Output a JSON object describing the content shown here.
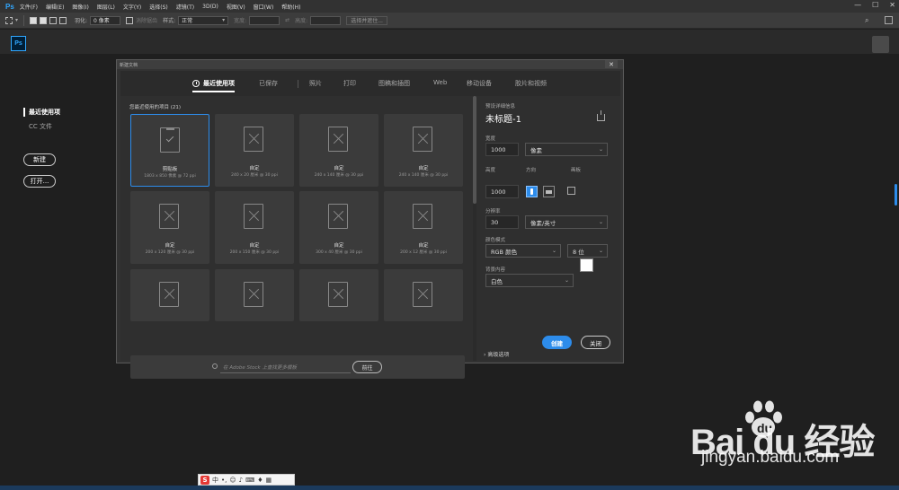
{
  "menubar": {
    "logo": "Ps",
    "items": [
      "文件(F)",
      "编辑(E)",
      "图像(I)",
      "图层(L)",
      "文字(Y)",
      "选择(S)",
      "滤镜(T)",
      "3D(D)",
      "视图(V)",
      "窗口(W)",
      "帮助(H)"
    ],
    "window_controls": [
      "—",
      "☐",
      "✕"
    ]
  },
  "optionsbar": {
    "feather_label": "羽化:",
    "feather_value": "0 像素",
    "antialias": "消除锯齿",
    "style_label": "样式:",
    "style_value": "正常",
    "width_label": "宽度:",
    "height_label": "高度:",
    "select_mask": "选择并遮住..."
  },
  "workspace": {
    "ps_logo": "Ps"
  },
  "start_panel": {
    "recent": "最近使用项",
    "cc_files": "CC 文件",
    "new_button": "新建",
    "open_button": "打开..."
  },
  "dialog": {
    "title": "新建文档",
    "close": "✕",
    "tabs": [
      "最近使用项",
      "已保存",
      "照片",
      "打印",
      "图稿和插图",
      "Web",
      "移动设备",
      "胶片和视频"
    ],
    "section_label": "您最近使用的项目 (21)",
    "presets": [
      {
        "name": "剪贴板",
        "dims": "1803 x 850 像素 @ 72 ppi"
      },
      {
        "name": "自定",
        "dims": "240 x 20 厘米 @ 30 ppi"
      },
      {
        "name": "自定",
        "dims": "240 x 140 厘米 @ 30 ppi"
      },
      {
        "name": "自定",
        "dims": "240 x 140 厘米 @ 30 ppi"
      },
      {
        "name": "自定",
        "dims": "200 x 120 厘米 @ 30 ppi"
      },
      {
        "name": "自定",
        "dims": "200 x 150 厘米 @ 30 ppi"
      },
      {
        "name": "自定",
        "dims": "300 x 40 厘米 @ 30 ppi"
      },
      {
        "name": "自定",
        "dims": "200 x 12 厘米 @ 30 ppi"
      },
      {
        "name": "",
        "dims": ""
      },
      {
        "name": "",
        "dims": ""
      },
      {
        "name": "",
        "dims": ""
      },
      {
        "name": "",
        "dims": ""
      }
    ],
    "stock_placeholder": "在 Adobe Stock 上查找更多模板",
    "go_button": "前往",
    "details": {
      "heading": "预设详细信息",
      "doc_name": "未标题-1",
      "width_label": "宽度",
      "width_value": "1000",
      "width_unit": "像素",
      "height_label": "高度",
      "height_value": "1000",
      "orientation_label": "方向",
      "artboard_label": "画板",
      "resolution_label": "分辨率",
      "resolution_value": "30",
      "resolution_unit": "像素/英寸",
      "color_mode_label": "颜色模式",
      "color_mode_value": "RGB 颜色",
      "bit_depth": "8 位",
      "background_label": "背景内容",
      "background_value": "白色",
      "background_color": "#ffffff",
      "advanced": "高级选项"
    },
    "create_button": "创建",
    "close_button": "关闭"
  },
  "watermark": {
    "logo_text": "Bai  du 经验",
    "url": "jingyan.baidu.com"
  },
  "ime": {
    "label": "S",
    "mode": "中"
  },
  "colors": {
    "accent": "#2d8ceb",
    "ps_blue": "#31a8ff",
    "bg": "#1f1f1f"
  }
}
